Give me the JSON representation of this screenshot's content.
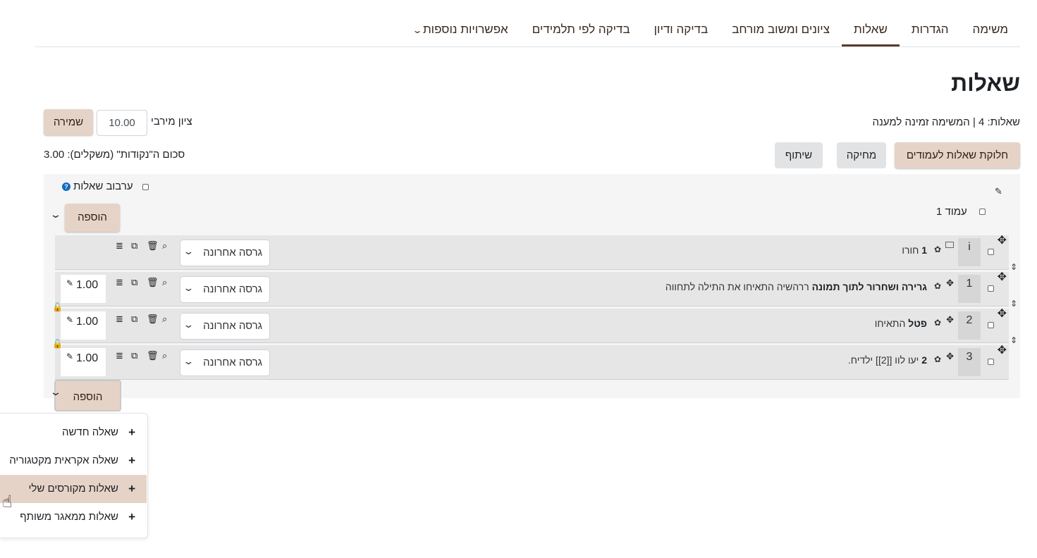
{
  "tabs": [
    {
      "label": "משימה",
      "active": false
    },
    {
      "label": "הגדרות",
      "active": false
    },
    {
      "label": "שאלות",
      "active": true
    },
    {
      "label": "ציונים ומשוב מורחב",
      "active": false
    },
    {
      "label": "בדיקה ודיון",
      "active": false
    },
    {
      "label": "בדיקה לפי תלמידים",
      "active": false
    },
    {
      "label": "אפשרויות נוספות",
      "active": false
    }
  ],
  "page_title": "שאלות",
  "summary": "שאלות: 4 | המשימה זמינה למענה",
  "max_grade": {
    "label": "ציון מירבי",
    "value": "10.00",
    "save_label": "שמירה"
  },
  "total_marks": "סכום ה\"נקודות\" (משקלים): 3.00",
  "actions": {
    "repaginate": "חלוקת שאלות לעמודים",
    "delete": "מחיקה",
    "share": "שיתוף"
  },
  "shuffle_label": "ערבוב שאלות",
  "page_label": "עמוד 1",
  "add_label": "הוספה",
  "questions": [
    {
      "num": "i",
      "bold": "1",
      "text": "חורו",
      "version": "גרסה אחרונה",
      "mark": ""
    },
    {
      "num": "1",
      "bold": "גרירה ושחרור לתוך תמונה",
      "text": "ררהשיה התאיחו את התילה לתחווה",
      "version": "גרסה אחרונה",
      "mark": "1.00"
    },
    {
      "num": "2",
      "bold": "פטל",
      "text": "התאיחו",
      "version": "גרסה אחרונה",
      "mark": "1.00"
    },
    {
      "num": "3",
      "bold": "2",
      "text": "יעו לוו [[2]] ילדיח.",
      "version": "גרסה אחרונה",
      "mark": "1.00"
    }
  ],
  "add_menu": [
    {
      "label": "שאלה חדשה",
      "highlighted": false
    },
    {
      "label": "שאלה אקראית מקטגוריה",
      "highlighted": false
    },
    {
      "label": "שאלות מקורסים שלי",
      "highlighted": true
    },
    {
      "label": "שאלות ממאגר משותף",
      "highlighted": false
    }
  ],
  "colors": {
    "accent": "#e6d3c7",
    "tab_underline": "#5a3a2c",
    "row_bg": "#e6e6e6",
    "help_icon": "#0f6cbf"
  },
  "icons": [
    "pencil-icon",
    "move-icon",
    "gear-icon",
    "copy-icon",
    "trash-icon",
    "zoom-icon",
    "database-icon",
    "lock-icon",
    "chevron-down-icon",
    "help-icon",
    "plus-icon",
    "pointer-cursor-icon"
  ]
}
